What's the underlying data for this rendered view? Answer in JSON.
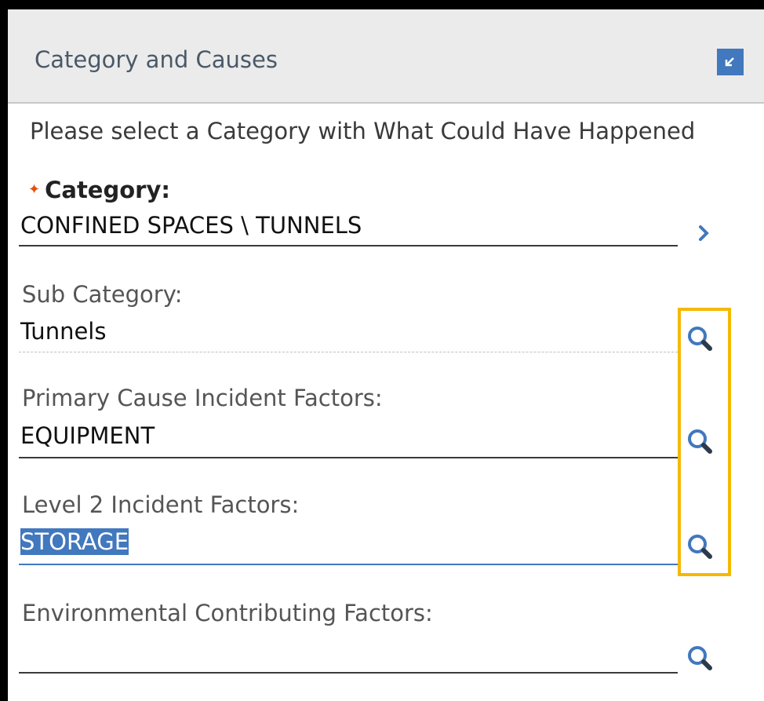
{
  "panel": {
    "title": "Category and Causes",
    "instruction": "Please select a Category with What Could Have Happened"
  },
  "fields": {
    "category": {
      "label": "Category:",
      "value": "CONFINED SPACES \\ TUNNELS",
      "required": true
    },
    "sub_category": {
      "label": "Sub Category:",
      "value": "Tunnels"
    },
    "primary_cause": {
      "label": "Primary Cause Incident Factors:",
      "value": "EQUIPMENT"
    },
    "level2": {
      "label": "Level 2 Incident Factors:",
      "value": "STORAGE"
    },
    "environmental": {
      "label": "Environmental Contributing Factors:",
      "value": ""
    }
  },
  "icons": {
    "collapse": "collapse-icon",
    "category_nav": "chevron-right-icon",
    "lookup": "search-icon"
  },
  "colors": {
    "accent": "#4178be",
    "required": "#e3500f",
    "highlight": "#f5b800",
    "header_bg": "#ebebeb"
  }
}
